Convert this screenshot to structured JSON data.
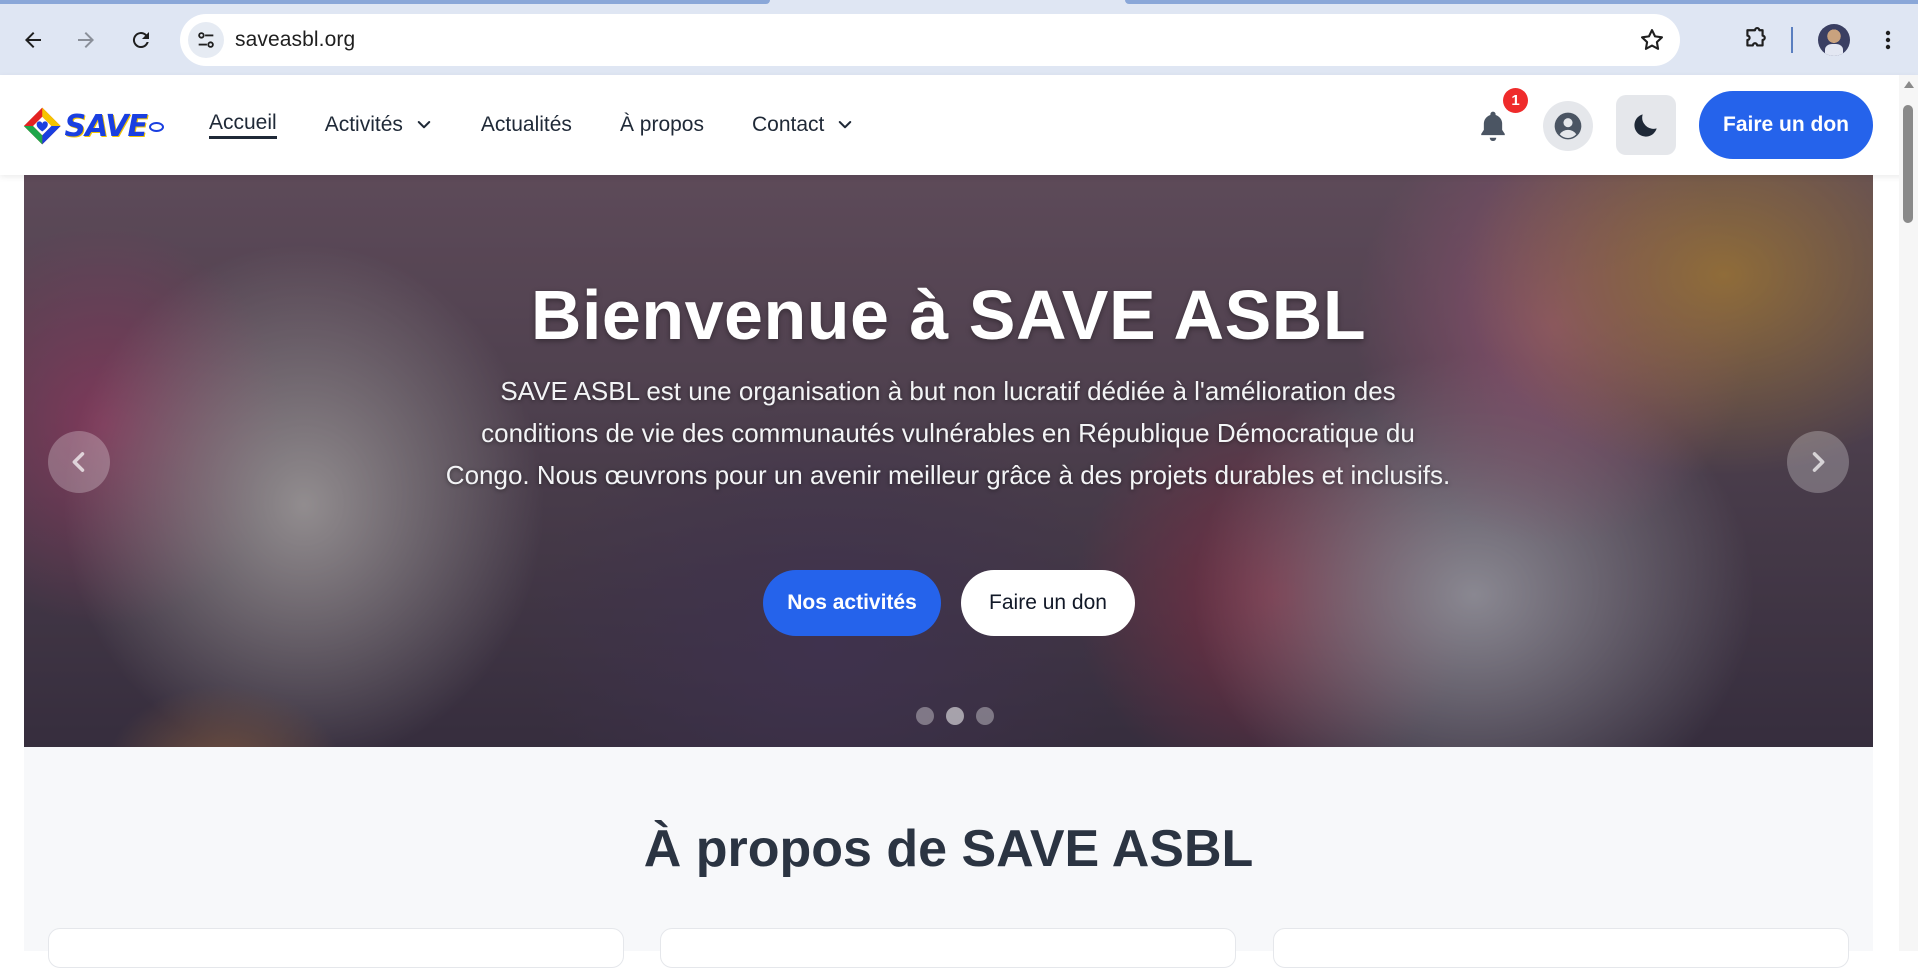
{
  "browser": {
    "url": "saveasbl.org",
    "icons": [
      "back-icon",
      "forward-icon",
      "reload-icon",
      "site-info-icon",
      "bookmark-star-icon",
      "extensions-icon",
      "profile-avatar",
      "more-menu-icon"
    ]
  },
  "header": {
    "logo_text": "SAVE",
    "nav": [
      {
        "label": "Accueil",
        "active": true
      },
      {
        "label": "Activités",
        "dropdown": true
      },
      {
        "label": "Actualités"
      },
      {
        "label": "À propos"
      },
      {
        "label": "Contact",
        "dropdown": true
      }
    ],
    "notification_count": "1",
    "donate_label": "Faire un don"
  },
  "hero": {
    "title": "Bienvenue à SAVE ASBL",
    "text": "SAVE ASBL est une organisation à but non lucratif dédiée à l'amélioration des conditions de vie des communautés vulnérables en République Démocratique du Congo. Nous œuvrons pour un avenir meilleur grâce à des projets durables et inclusifs.",
    "primary_button": "Nos activités",
    "secondary_button": "Faire un don",
    "slide_count": 3,
    "active_slide": 2
  },
  "about": {
    "title": "À propos de SAVE ASBL"
  },
  "colors": {
    "primary": "#2563eb",
    "badge": "#ef2b2b",
    "chrome": "#dfe6f3"
  }
}
